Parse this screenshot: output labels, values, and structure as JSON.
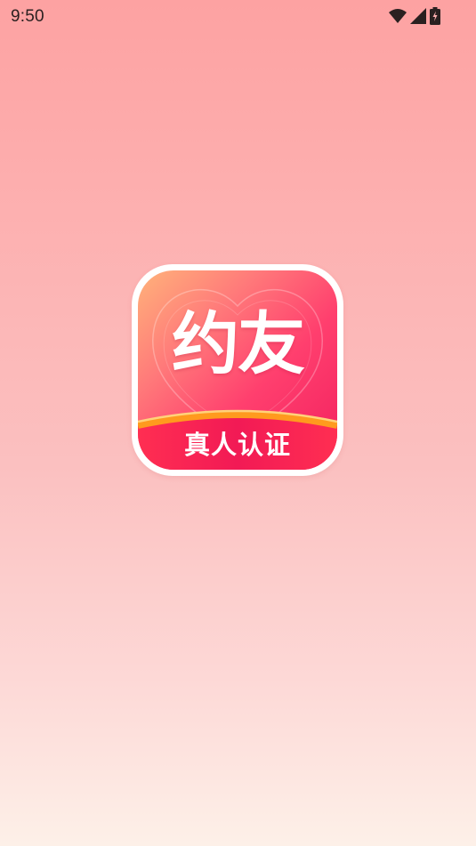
{
  "status_bar": {
    "time": "9:50",
    "icons": [
      "wifi-icon",
      "cell-signal-icon",
      "battery-charging-icon"
    ]
  },
  "splash": {
    "logo_title": "约友",
    "logo_badge": "真人认证"
  },
  "colors": {
    "background_top": "#fda2a2",
    "background_bottom": "#fdf0e8",
    "logo_gradient_start": "#ffb37a",
    "logo_gradient_end": "#f21f5e",
    "badge_arc": "#ff9a1e"
  }
}
